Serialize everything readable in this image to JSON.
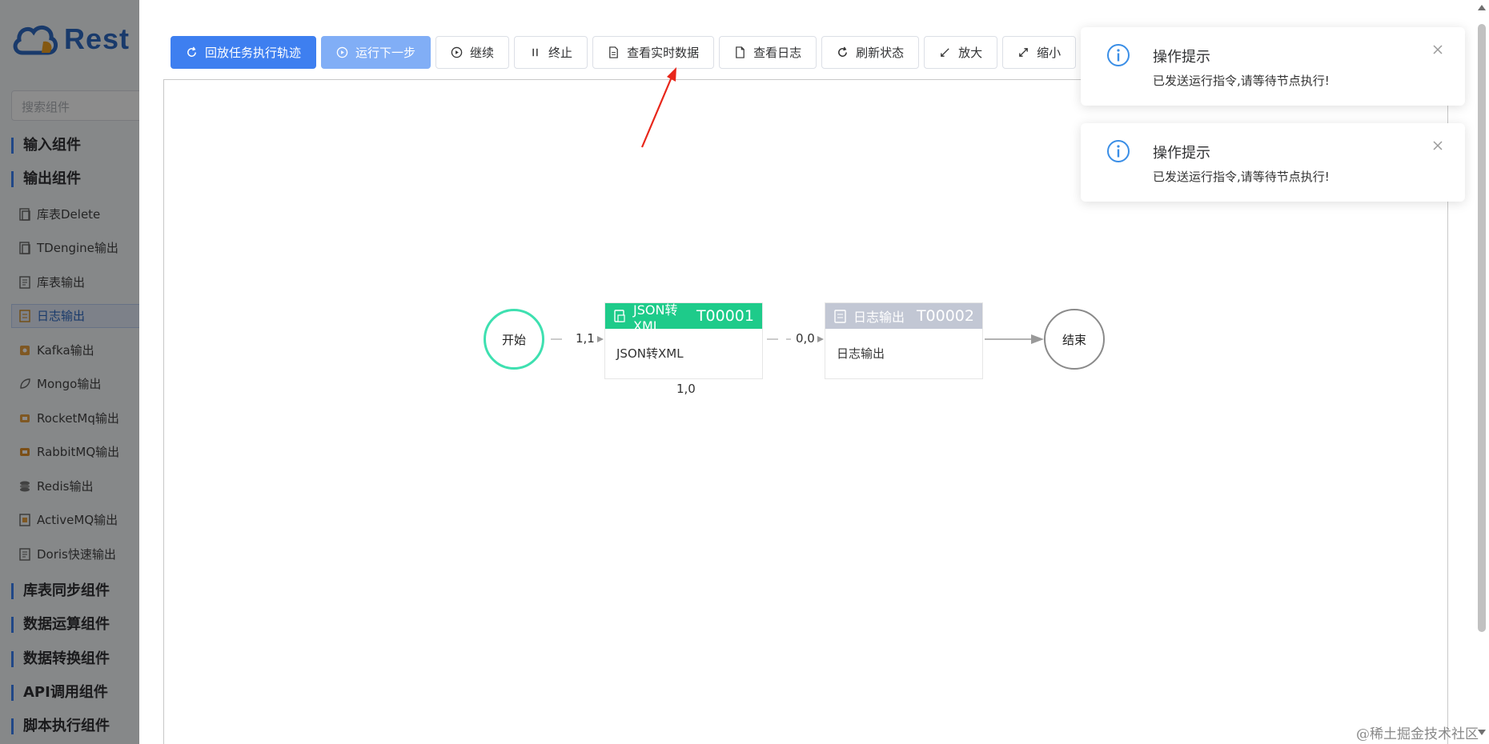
{
  "app": {
    "logo_text": "Rest"
  },
  "sidebar": {
    "search_placeholder": "搜索组件",
    "categories": [
      {
        "label": "输入组件"
      },
      {
        "label": "输出组件"
      },
      {
        "label": "库表同步组件"
      },
      {
        "label": "数据运算组件"
      },
      {
        "label": "数据转换组件"
      },
      {
        "label": "API调用组件"
      },
      {
        "label": "脚本执行组件"
      }
    ],
    "items": [
      {
        "label": "库表Delete",
        "icon": "document-icon"
      },
      {
        "label": "TDengine输出",
        "icon": "document-icon"
      },
      {
        "label": "库表输出",
        "icon": "table-icon"
      },
      {
        "label": "日志输出",
        "icon": "log-icon",
        "active": true
      },
      {
        "label": "Kafka输出",
        "icon": "kafka-icon"
      },
      {
        "label": "Mongo输出",
        "icon": "leaf-icon"
      },
      {
        "label": "RocketMq输出",
        "icon": "rocket-icon"
      },
      {
        "label": "RabbitMQ输出",
        "icon": "rabbit-icon"
      },
      {
        "label": "Redis输出",
        "icon": "stack-icon"
      },
      {
        "label": "ActiveMQ输出",
        "icon": "queue-icon"
      },
      {
        "label": "Doris快速输出",
        "icon": "table-icon"
      }
    ]
  },
  "toolbar": {
    "buttons": [
      {
        "label": "回放任务执行轨迹",
        "icon": "refresh-icon",
        "style": "primary"
      },
      {
        "label": "运行下一步",
        "icon": "play-circle-icon",
        "style": "primary-light"
      },
      {
        "label": "继续",
        "icon": "play-circle-icon"
      },
      {
        "label": "终止",
        "icon": "pause-icon"
      },
      {
        "label": "查看实时数据",
        "icon": "document-icon"
      },
      {
        "label": "查看日志",
        "icon": "file-icon"
      },
      {
        "label": "刷新状态",
        "icon": "refresh-icon"
      },
      {
        "label": "放大",
        "icon": "zoom-in-icon"
      },
      {
        "label": "缩小",
        "icon": "zoom-out-icon"
      }
    ]
  },
  "flow": {
    "start": "开始",
    "end": "结束",
    "nodes": [
      {
        "name": "JSON转XML",
        "id": "T00001",
        "body": "JSON转XML",
        "header_color": "#1ecb8a"
      },
      {
        "name": "日志输出",
        "id": "T00002",
        "body": "日志输出",
        "header_color": "#c2c7d4"
      }
    ],
    "edge_labels": {
      "start_to_n1": "1,1",
      "n1_below": "1,0",
      "n1_to_n2": "0,0"
    },
    "colors": {
      "start_border": "#3ee0b0",
      "end_border": "#8a8a8a"
    }
  },
  "notifications": [
    {
      "title": "操作提示",
      "message": "已发送运行指令,请等待节点执行!"
    },
    {
      "title": "操作提示",
      "message": "已发送运行指令,请等待节点执行!"
    }
  ],
  "colors": {
    "primary": "#3e7ff0",
    "primary_light": "#81aef6",
    "info": "#3a8ee6",
    "annotation_arrow": "#e8261a"
  },
  "watermark": "@稀土掘金技术社区"
}
